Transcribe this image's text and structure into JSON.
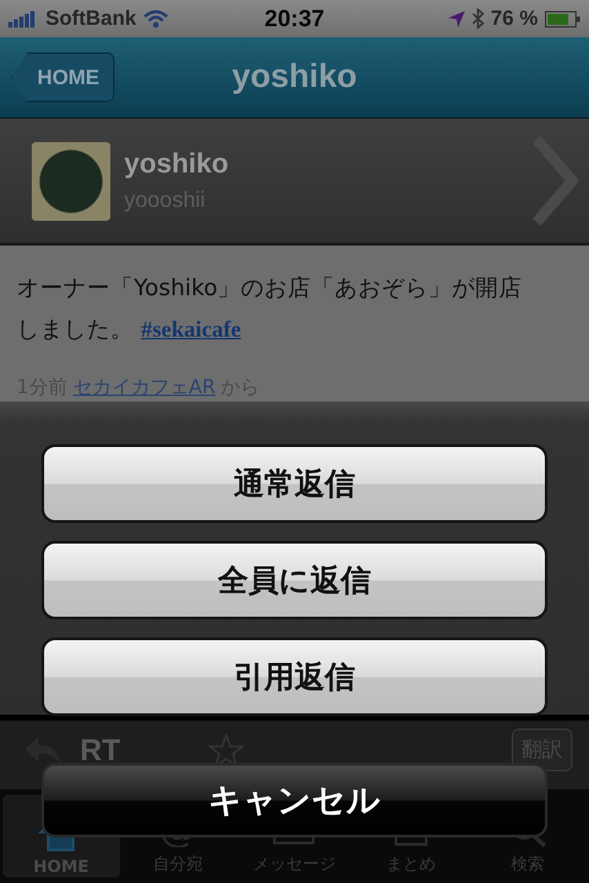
{
  "status_bar": {
    "carrier": "SoftBank",
    "time": "20:37",
    "battery": "76 %"
  },
  "nav": {
    "back_button": "HOME",
    "title": "yoshiko"
  },
  "profile": {
    "name": "yoshiko",
    "handle": "yoooshii"
  },
  "tweet": {
    "text": "オーナー「Yoshiko」のお店「あおぞら」が開店しました。",
    "hashtag": "#sekaicafe",
    "time": "1分前",
    "source": "セカイカフェAR",
    "source_suffix": "から"
  },
  "toolbar": {
    "retweet": "RT",
    "translate_button": "翻訳"
  },
  "tabs": [
    {
      "label": "HOME",
      "selected": true
    },
    {
      "label": "自分宛",
      "selected": false
    },
    {
      "label": "メッセージ",
      "selected": false
    },
    {
      "label": "まとめ",
      "selected": false
    },
    {
      "label": "検索",
      "selected": false
    }
  ],
  "action_sheet": [
    {
      "label": "通常返信",
      "kind": "default"
    },
    {
      "label": "全員に返信",
      "kind": "default"
    },
    {
      "label": "引用返信",
      "kind": "default"
    },
    {
      "label": "キャンセル",
      "kind": "cancel"
    }
  ]
}
